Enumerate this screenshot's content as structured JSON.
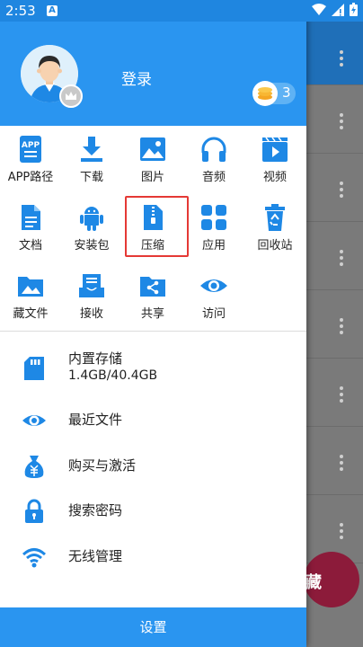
{
  "status_bar": {
    "time": "2:53",
    "notification_glyph": "A"
  },
  "header": {
    "login_label": "登录",
    "coin_count": "3"
  },
  "grid": [
    {
      "id": "app-path",
      "label": "APP路径",
      "icon": "app-icon"
    },
    {
      "id": "download",
      "label": "下载",
      "icon": "download-icon"
    },
    {
      "id": "images",
      "label": "图片",
      "icon": "image-icon"
    },
    {
      "id": "audio",
      "label": "音频",
      "icon": "headphones-icon"
    },
    {
      "id": "video",
      "label": "视频",
      "icon": "video-icon"
    },
    {
      "id": "documents",
      "label": "文档",
      "icon": "document-icon"
    },
    {
      "id": "apk",
      "label": "安装包",
      "icon": "android-icon"
    },
    {
      "id": "compress",
      "label": "压缩",
      "icon": "zip-icon"
    },
    {
      "id": "apps",
      "label": "应用",
      "icon": "apps-grid-icon"
    },
    {
      "id": "recycle",
      "label": "回收站",
      "icon": "recycle-bin-icon"
    },
    {
      "id": "hidden",
      "label": "藏文件",
      "icon": "hidden-folder-icon"
    },
    {
      "id": "receive",
      "label": "接收",
      "icon": "inbox-icon"
    },
    {
      "id": "share",
      "label": "共享",
      "icon": "share-folder-icon"
    },
    {
      "id": "visit",
      "label": "访问",
      "icon": "eye-icon"
    }
  ],
  "menu": {
    "storage_title": "内置存储",
    "storage_size": "1.4GB/40.4GB",
    "recent": "最近文件",
    "purchase": "购买与激活",
    "password": "搜索密码",
    "wireless": "无线管理"
  },
  "settings_label": "设置",
  "fab_text": "藏",
  "colors": {
    "primary": "#2a95f0",
    "icon_blue": "#1e88e5",
    "highlight": "#e53935"
  }
}
